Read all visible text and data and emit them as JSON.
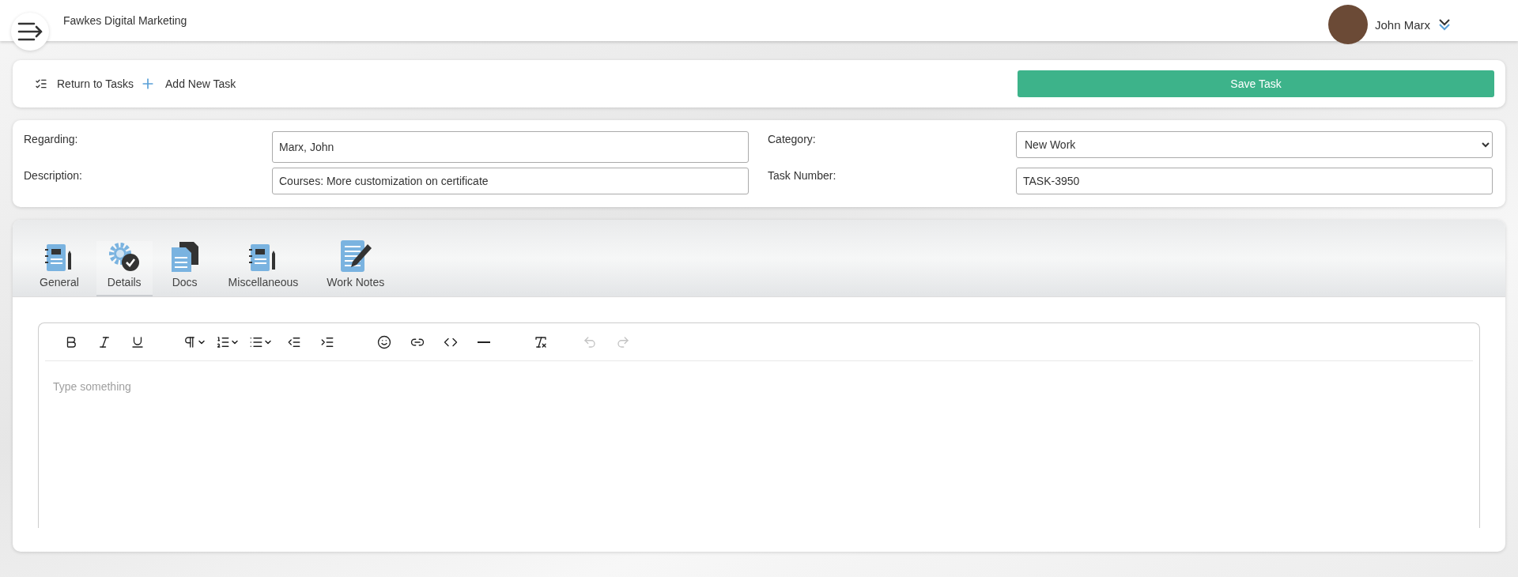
{
  "header": {
    "company": "Fawkes Digital Marketing",
    "user": {
      "name": "John Marx"
    }
  },
  "actions": {
    "return_link": "Return to Tasks",
    "add_link": "Add New Task",
    "save_button": "Save Task"
  },
  "form": {
    "left": [
      {
        "label": "Regarding:",
        "value": "Marx, John",
        "kind": "text"
      },
      {
        "label": "Description:",
        "value": "Courses: More customization on certificate",
        "kind": "text"
      }
    ],
    "right": [
      {
        "label": "Category:",
        "value": "New Work",
        "kind": "select"
      },
      {
        "label": "Task Number:",
        "value": "TASK-3950",
        "kind": "text"
      }
    ]
  },
  "tabs": [
    {
      "label": "General",
      "kind": "notebook",
      "selected": false
    },
    {
      "label": "Details",
      "kind": "gear",
      "selected": true
    },
    {
      "label": "Docs",
      "kind": "docs",
      "selected": false
    },
    {
      "label": "Miscellaneous",
      "kind": "notebook",
      "selected": false
    },
    {
      "label": "Work Notes",
      "kind": "notes",
      "selected": false
    }
  ],
  "editor": {
    "placeholder": "Type something",
    "toolbar": [
      {
        "kind": "bold",
        "disabled": false
      },
      {
        "kind": "italic",
        "disabled": false
      },
      {
        "kind": "underline",
        "disabled": false
      },
      {
        "kind": "paragraph",
        "disabled": false
      },
      {
        "kind": "ordered",
        "disabled": false
      },
      {
        "kind": "bullets",
        "disabled": false
      },
      {
        "kind": "outdent",
        "disabled": false
      },
      {
        "kind": "indent",
        "disabled": false
      },
      {
        "kind": "emoji",
        "disabled": false
      },
      {
        "kind": "link",
        "disabled": false
      },
      {
        "kind": "code",
        "disabled": false
      },
      {
        "kind": "rule",
        "disabled": false
      },
      {
        "kind": "clear",
        "disabled": false
      },
      {
        "kind": "undo",
        "disabled": true
      },
      {
        "kind": "redo",
        "disabled": true
      }
    ]
  }
}
